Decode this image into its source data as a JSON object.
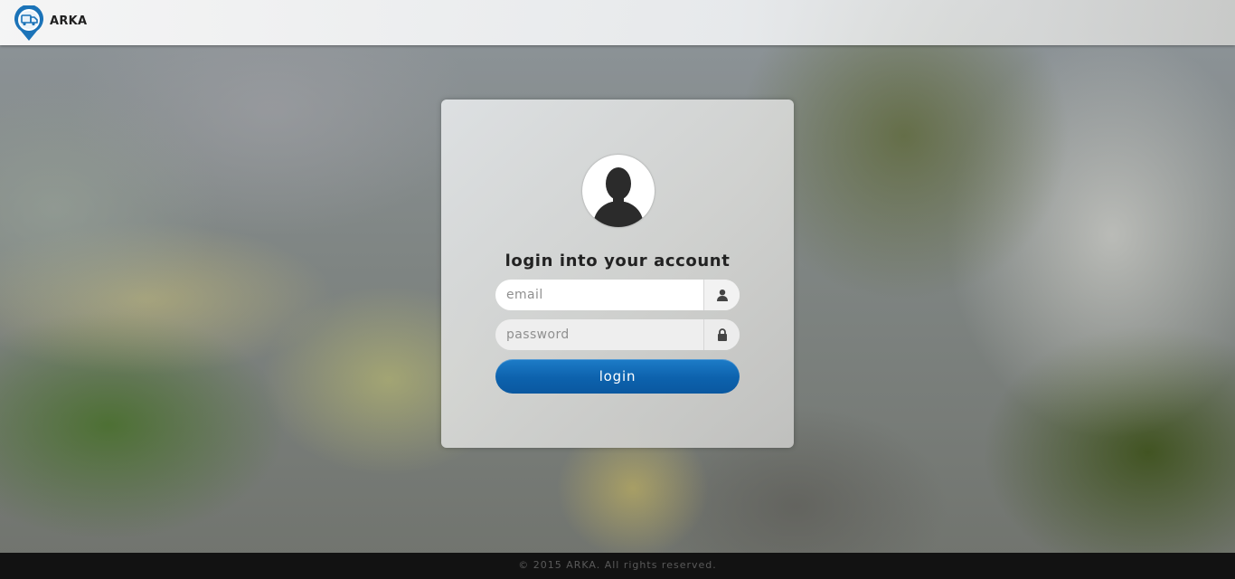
{
  "header": {
    "brand": "ARKA",
    "logo_icon": "truck-location-pin-icon"
  },
  "login": {
    "avatar_icon": "user-silhouette-icon",
    "title": "login into your account",
    "email_placeholder": "email",
    "email_value": "",
    "email_icon": "user-icon",
    "password_placeholder": "password",
    "password_value": "",
    "password_icon": "lock-icon",
    "submit_label": "login"
  },
  "footer": {
    "copyright": "© 2015 ARKA. All rights reserved."
  },
  "colors": {
    "accent": "#0d62ad",
    "logo_blue": "#1b73b8",
    "footer_bg": "#121212"
  }
}
